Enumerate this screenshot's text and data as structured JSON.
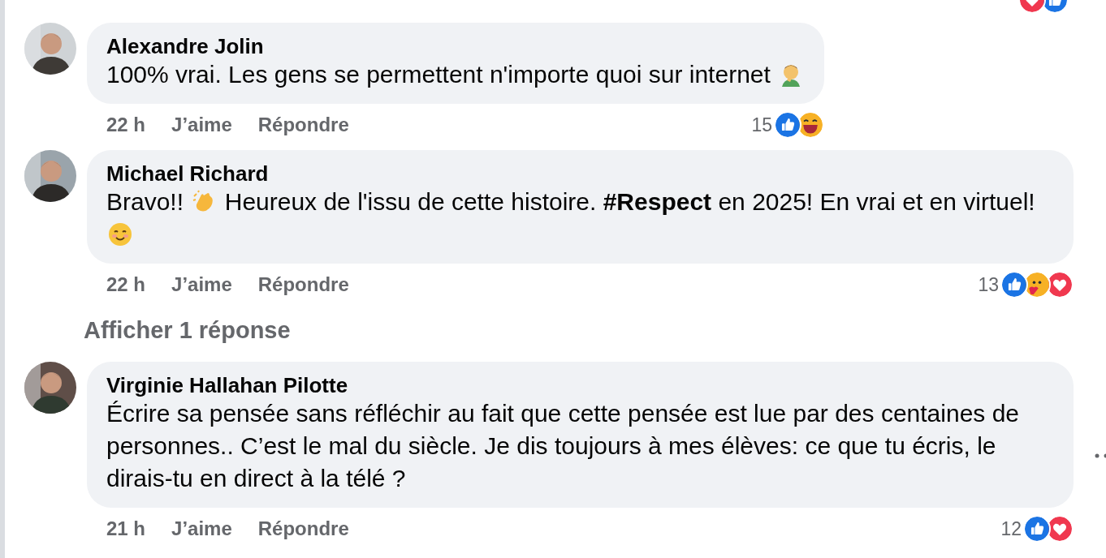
{
  "top_reactions": [
    {
      "kind": "love"
    },
    {
      "kind": "like"
    }
  ],
  "comments": [
    {
      "author": "Alexandre Jolin",
      "body": [
        {
          "kind": "text",
          "text": "100% vrai. Les gens se permettent n'importe quoi sur internet "
        },
        {
          "kind": "facepalm"
        }
      ],
      "time": "22 h",
      "like": "J’aime",
      "reply": "Répondre",
      "count": "15",
      "reactions": [
        {
          "kind": "like"
        },
        {
          "kind": "haha"
        }
      ],
      "more_options": false
    },
    {
      "author": "Michael Richard",
      "body": [
        {
          "kind": "text",
          "text": "Bravo!! "
        },
        {
          "kind": "clap"
        },
        {
          "kind": "text",
          "text": " Heureux de l'issu de cette histoire. **#Respect** en 2025! En vrai et en virtuel! "
        },
        {
          "kind": "smile"
        }
      ],
      "time": "22 h",
      "like": "J’aime",
      "reply": "Répondre",
      "count": "13",
      "reactions": [
        {
          "kind": "like"
        },
        {
          "kind": "care"
        },
        {
          "kind": "love"
        }
      ],
      "more_options": false,
      "replies_link": "Afficher 1 réponse"
    },
    {
      "author": "Virginie Hallahan Pilotte",
      "body": [
        {
          "kind": "text",
          "text": "Écrire sa pensée sans réfléchir au fait que cette pensée est lue par des centaines de personnes.. C’est le mal du siècle. Je dis toujours à mes élèves: ce que tu écris, le dirais-tu en direct à la télé ?"
        }
      ],
      "time": "21 h",
      "like": "J’aime",
      "reply": "Répondre",
      "count": "12",
      "reactions": [
        {
          "kind": "like"
        },
        {
          "kind": "love"
        }
      ],
      "more_options": true
    }
  ]
}
